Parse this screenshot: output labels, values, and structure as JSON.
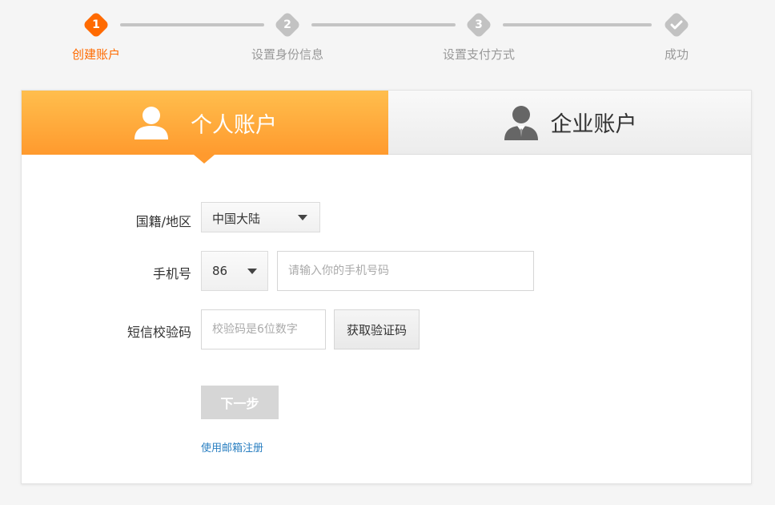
{
  "steps": [
    {
      "number": "1",
      "label": "创建账户",
      "state": "active"
    },
    {
      "number": "2",
      "label": "设置身份信息",
      "state": "pending"
    },
    {
      "number": "3",
      "label": "设置支付方式",
      "state": "pending"
    },
    {
      "number": "",
      "label": "成功",
      "state": "pending",
      "icon": "check-icon"
    }
  ],
  "tabs": {
    "personal": {
      "label": "个人账户",
      "icon": "person-icon",
      "active": true
    },
    "business": {
      "label": "企业账户",
      "icon": "businessman-icon",
      "active": false
    }
  },
  "form": {
    "region": {
      "label": "国籍/地区",
      "value": "中国大陆"
    },
    "phone": {
      "label": "手机号",
      "country_code": "86",
      "placeholder": "请输入你的手机号码"
    },
    "sms": {
      "label": "短信校验码",
      "placeholder": "校验码是6位数字",
      "get_code_label": "获取验证码"
    },
    "next_label": "下一步",
    "email_link": "使用邮箱注册"
  },
  "colors": {
    "accent": "#ff6a00",
    "tab_active_top": "#ffbe4d",
    "tab_active_bottom": "#ff9a2e",
    "link": "#2a7fc1",
    "disabled_button": "#d6d6d6"
  }
}
